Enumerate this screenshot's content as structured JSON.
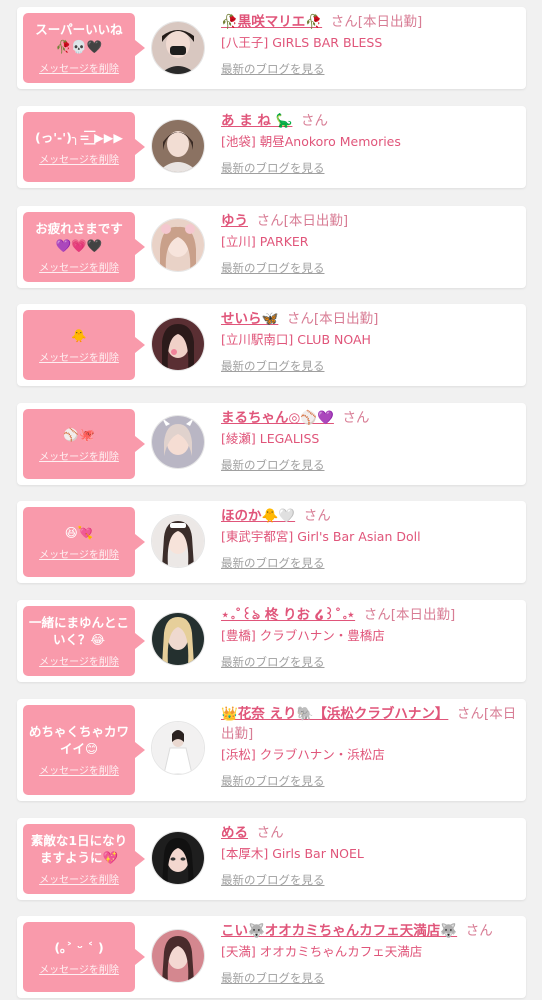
{
  "delete_label": "メッセージを削除",
  "blog_label": "最新のブログを見る",
  "san": "さん",
  "cards": [
    {
      "message": "スーパーいいね\n🥀💀🖤",
      "name": "🥀黒咲マリエ🥀",
      "on_duty": "[本日出勤]",
      "shop": "[八王子] GIRLS BAR BLESS",
      "avatar_bg": "#2a2a2a"
    },
    {
      "message": "(っ'-')╮=͟͟͞͞ ▶▶▶",
      "name": "あ ま ね 🦕",
      "on_duty": "",
      "shop": "[池袋] 朝昼Anokoro Memories",
      "avatar_bg": "#5a4a45"
    },
    {
      "message": "お疲れさまです\n💜💗🖤",
      "name": "ゆう",
      "on_duty": "[本日出勤]",
      "shop": "[立川] PARKER",
      "avatar_bg": "#d9b7a8"
    },
    {
      "message": "🐥",
      "name": "せいら🦋",
      "on_duty": "[本日出勤]",
      "shop": "[立川駅南口] CLUB NOAH",
      "avatar_bg": "#6b3c3a"
    },
    {
      "message": "⚾️🐙",
      "name": "まるちゃん◎⚾️💜",
      "on_duty": "",
      "shop": "[綾瀬] LEGALISS",
      "avatar_bg": "#8a8597"
    },
    {
      "message": "😆💘",
      "name": "ほのか🐥🤍",
      "on_duty": "",
      "shop": "[東武宇都宮] Girl's Bar Asian Doll",
      "avatar_bg": "#e7e2df"
    },
    {
      "message": "一緒にまゆんとこ\nいく？😂",
      "name": "⋆｡˚꒰ঌ 柊 りお ໒꒱˚｡⋆",
      "on_duty": "[本日出勤]",
      "shop": "[豊橋] クラブハナン・豊橋店",
      "avatar_bg": "#2f3b3a"
    },
    {
      "message": "めちゃくちゃカワ\nイイ😊",
      "name": "👑花奈 えり🐘【浜松クラブハナン】",
      "on_duty": "[本日出勤]",
      "shop": "[浜松] クラブハナン・浜松店",
      "avatar_bg": "#efeeee"
    },
    {
      "message": "素敵な1日になり\nますように💖",
      "name": "める",
      "on_duty": "",
      "shop": "[本厚木] Girls Bar NOEL",
      "avatar_bg": "#222222"
    },
    {
      "message": "(｡˃ ᵕ ˂ )",
      "name": "こい🐺オオカミちゃんカフェ天満店🐺",
      "on_duty": "",
      "shop": "[天満] オオカミちゃんカフェ天満店",
      "avatar_bg": "#c9707e"
    }
  ]
}
